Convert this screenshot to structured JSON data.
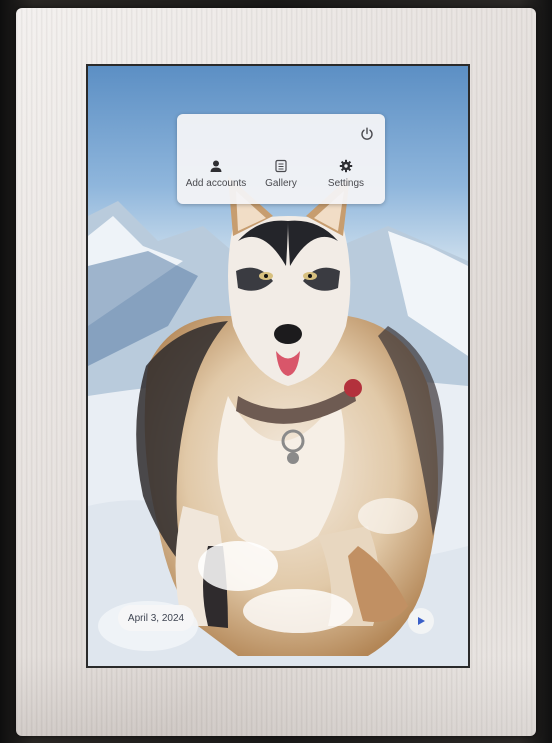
{
  "quick_menu": {
    "power_icon": "power-icon",
    "items": [
      {
        "label": "Add accounts",
        "icon": "person-icon"
      },
      {
        "label": "Gallery",
        "icon": "gallery-icon"
      },
      {
        "label": "Settings",
        "icon": "gear-icon"
      }
    ]
  },
  "slideshow": {
    "date": "April 3, 2024",
    "play_icon": "play-icon"
  },
  "colors": {
    "menu_text": "#4a4a4f",
    "play_accent": "#3a5fc8",
    "frame": "#e8e3e0"
  }
}
